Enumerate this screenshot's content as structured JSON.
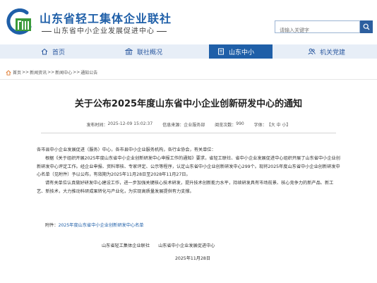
{
  "header": {
    "title": "山东省轻工集体企业联社",
    "subtitle": "山东省中小企业发展促进中心",
    "search_placeholder": "请输入关键字"
  },
  "nav": {
    "items": [
      {
        "label": "首页",
        "icon": "home-icon"
      },
      {
        "label": "联社概况",
        "icon": "bank-icon"
      },
      {
        "label": "山东中小",
        "icon": "document-icon",
        "active": true
      },
      {
        "label": "机关党建",
        "icon": "users-icon"
      }
    ]
  },
  "breadcrumb": {
    "items": [
      "首页",
      "新闻资讯",
      "新闻中心",
      "通知公告"
    ],
    "separator": ">>"
  },
  "article": {
    "title": "关于公布2025年度山东省中小企业创新研发中心的通知",
    "meta": {
      "publish_label": "发布时间：",
      "publish_time": "2025-12-09 15:02:37",
      "source_label": "信息来源：",
      "source": "企业服务部",
      "views_label": "阅览次数：",
      "views": "990",
      "font_label": "字体：",
      "font_options": "【大 中 小】"
    },
    "paragraphs": [
      "各市县中小企业发展促进（服务）中心，各市县中小企业服务机构，各行业协会，有关单位：",
      "根据《关于组织开展2025年度山东省中小企业创新研发中心申报工作的通知》要求，省轻工联社、省中小企业发展促进中心组织开展了山东省中小企业创新研发中心评定工作。经企业申报、资料审核、专家评定、公示等程序，认定山东省中小企业创新研发中心299个。现将2025年度山东省中小企业创新研发中心名单（见附件）予以公布，有效期为2025年11月28日至2028年11月27日。",
      "请有关单位认真做好研发中心建设工作，进一步加强关键核心技术研发，提升技术创新能力水平，持续研发具有市场前景、核心竞争力的新产品、新工艺、新技术，大力推动科研成果转化与产业化，为实现高质量发展提供有力支撑。"
    ],
    "attachment_label": "附件：",
    "attachment_link": "2025年度山东省中小企业创新研发中心名单",
    "signatories": [
      "山东省轻工集体企业联社",
      "山东省中小企业发展促进中心"
    ],
    "date": "2025年11月28日"
  },
  "colors": {
    "brand": "#1f5fa8",
    "nav_bg": "#e7eef7",
    "search_btn": "#2d5f9f",
    "logo_green": "#3a9a3a"
  }
}
